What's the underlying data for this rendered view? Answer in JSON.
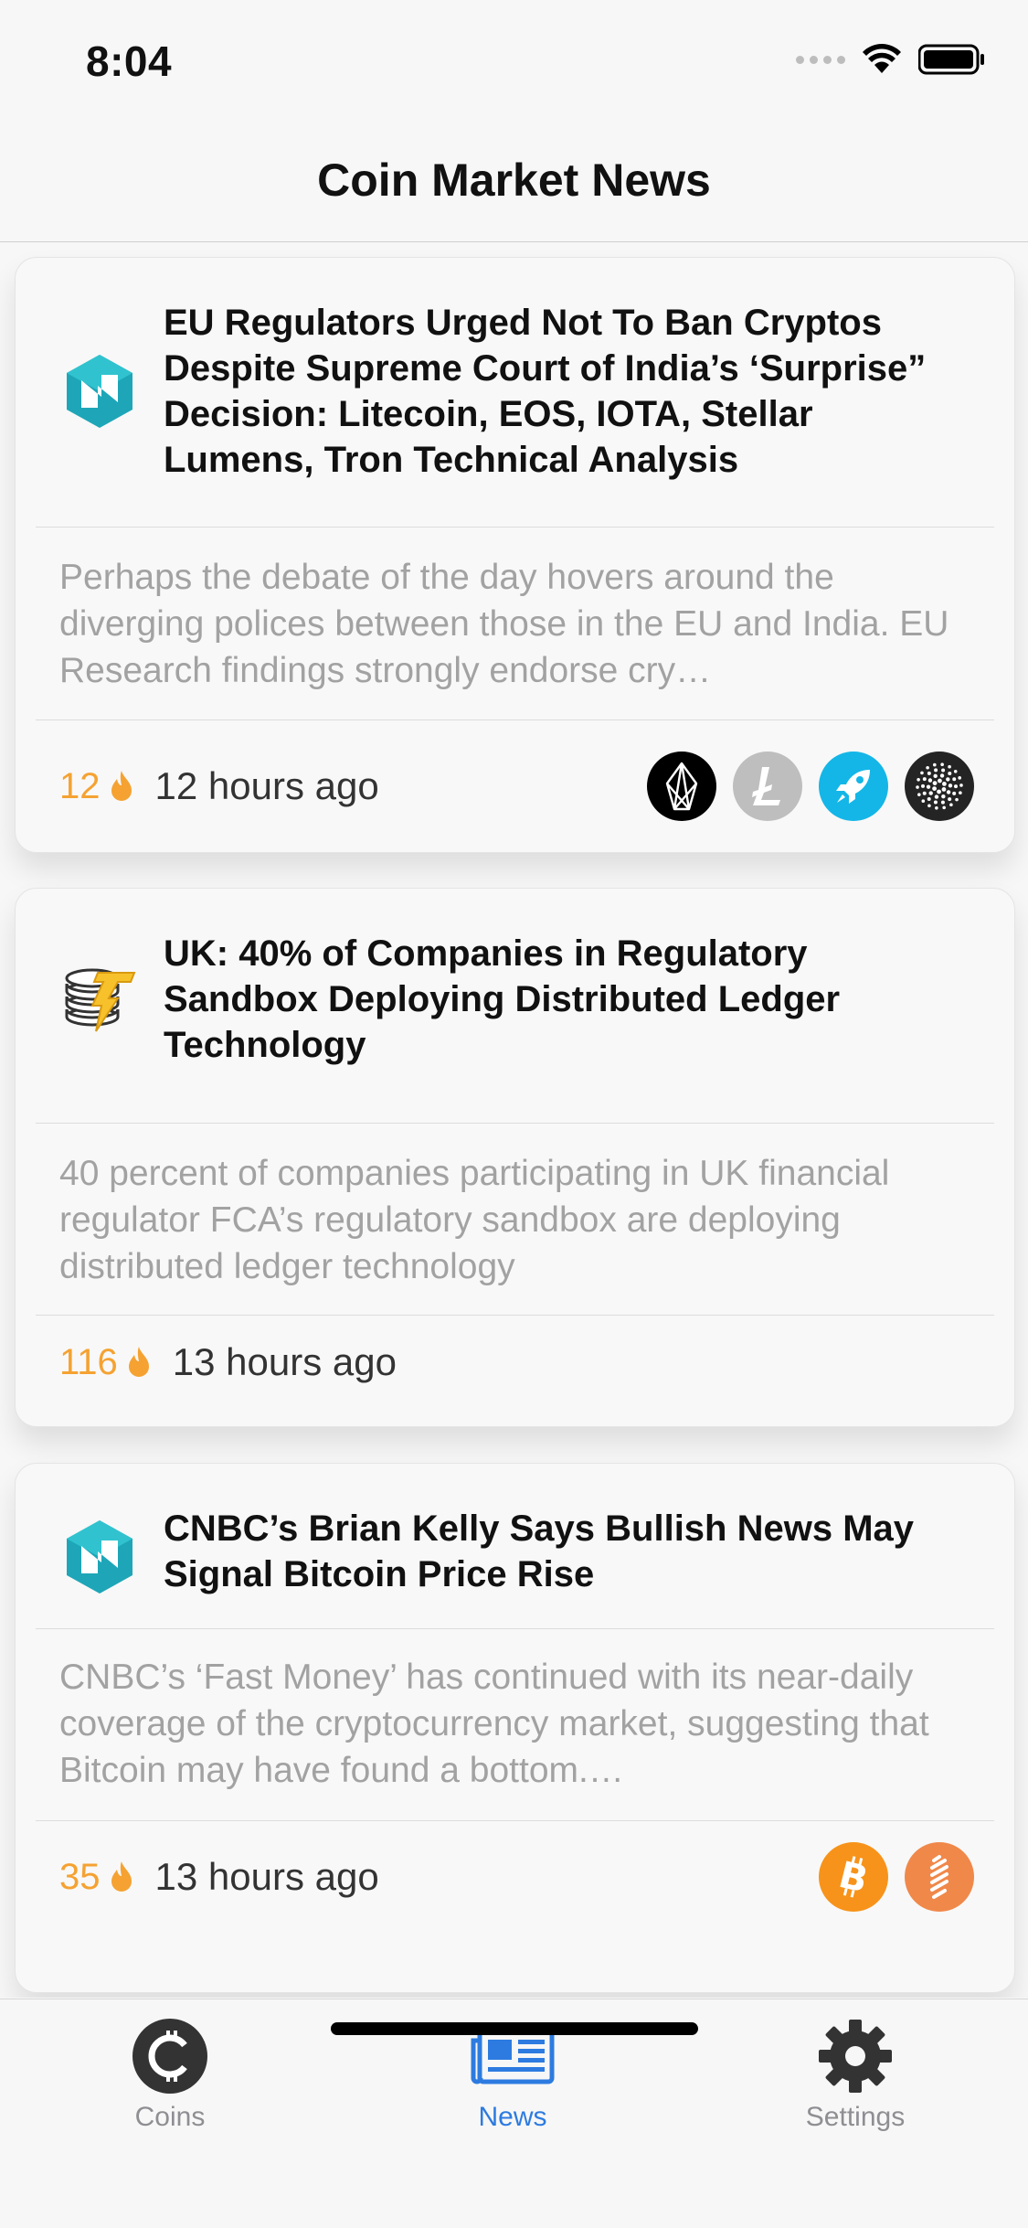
{
  "status": {
    "time": "8:04"
  },
  "nav": {
    "title": "Coin Market News"
  },
  "articles": [
    {
      "title": "EU Regulators Urged Not To Ban Cryptos Despite Supreme Court of India’s ‘Surprise” Decision: Litecoin, EOS, IOTA, Stellar Lumens, Tron Technical Analysis",
      "description": "Perhaps the debate of the day hovers around the diverging polices between those in the EU and India. EU Research findings strongly endorse cry…",
      "score": "12",
      "time": "12 hours ago",
      "source_icon": "newsbtc-logo",
      "coins": [
        "eos-icon",
        "litecoin-icon",
        "stellar-rocket-icon",
        "iota-icon"
      ]
    },
    {
      "title": "UK: 40% of Companies in Regulatory Sandbox Deploying Distributed Ledger Technology",
      "description": "40 percent of companies participating in UK financial regulator FCA’s regulatory sandbox are deploying distributed ledger technology",
      "score": "116",
      "time": "13 hours ago",
      "source_icon": "coin-stack-logo",
      "coins": []
    },
    {
      "title": "CNBC’s Brian Kelly Says Bullish News May Signal Bitcoin Price Rise",
      "description": "CNBC’s ‘Fast Money’ has continued with its near-daily coverage of the cryptocurrency market, suggesting that Bitcoin may have found a bottom.…",
      "score": "35",
      "time": "13 hours ago",
      "source_icon": "newsbtc-logo",
      "coins": [
        "bitcoin-icon",
        "coin-stripes-icon"
      ]
    }
  ],
  "tabs": [
    {
      "label": "Coins",
      "icon": "coin-icon",
      "active": false
    },
    {
      "label": "News",
      "icon": "newspaper-icon",
      "active": true
    },
    {
      "label": "Settings",
      "icon": "gear-icon",
      "active": false
    }
  ],
  "colors": {
    "accent": "#2d7be0",
    "score": "#f5a232",
    "inactive_tab": "#8e8e93",
    "description": "#a2a2a2",
    "eos": "#000000",
    "litecoin": "#bebebe",
    "stellar": "#14b6e7",
    "iota": "#242424",
    "bitcoin": "#f7931a",
    "stripes_coin": "#f0884a"
  }
}
